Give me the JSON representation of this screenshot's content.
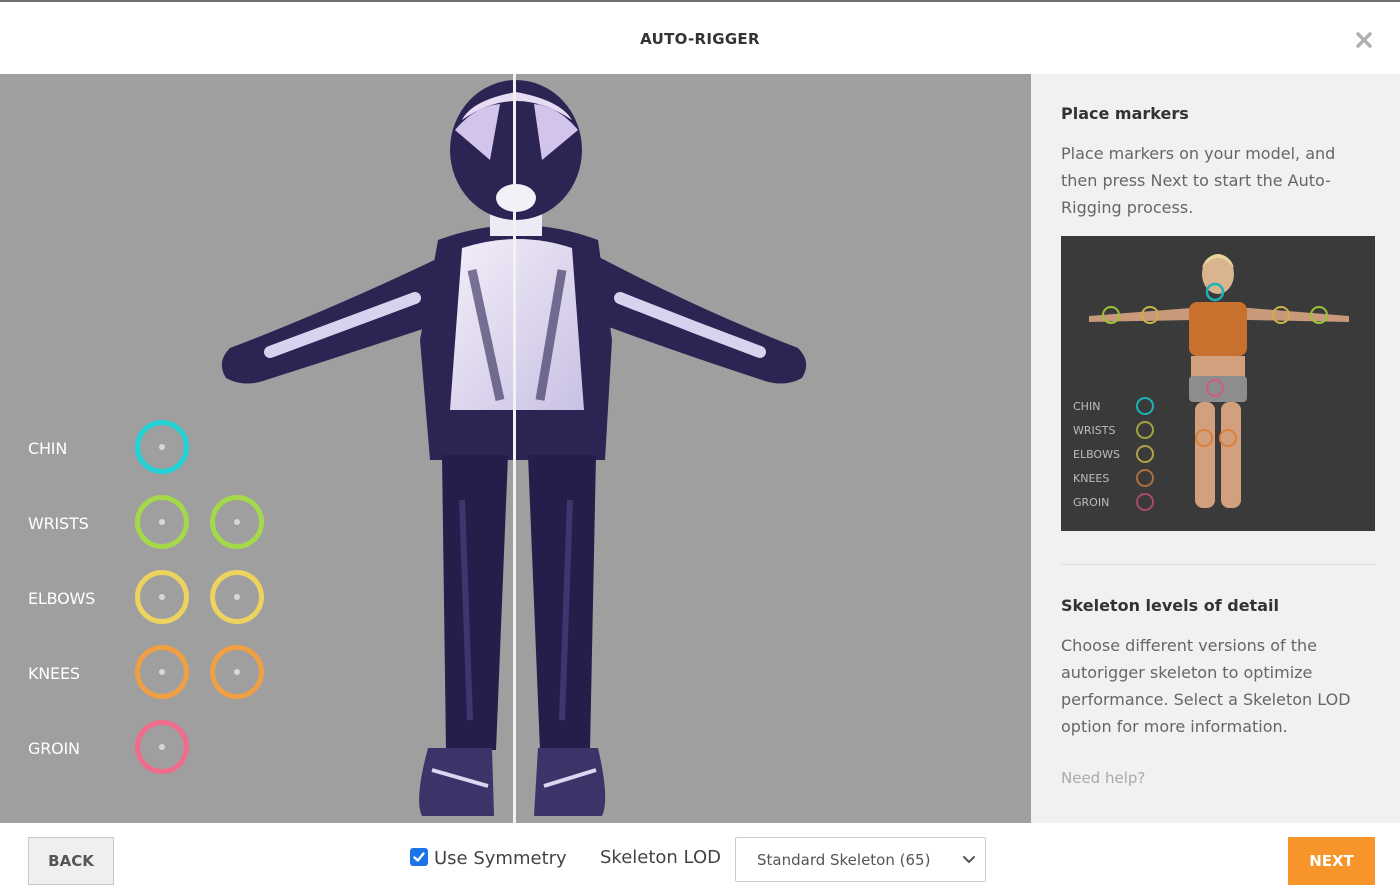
{
  "header": {
    "title": "AUTO-RIGGER"
  },
  "markers": {
    "chin": {
      "label": "CHIN",
      "color": "#22d3d8"
    },
    "wrists": {
      "label": "WRISTS",
      "color": "#a3d94a"
    },
    "elbows": {
      "label": "ELBOWS",
      "color": "#eed35f"
    },
    "knees": {
      "label": "KNEES",
      "color": "#f0a043"
    },
    "groin": {
      "label": "GROIN",
      "color": "#f06b8c"
    }
  },
  "side": {
    "place_title": "Place markers",
    "place_text": "Place markers on your model, and then press Next to start the Auto-Rigging process.",
    "preview_labels": [
      "CHIN",
      "WRISTS",
      "ELBOWS",
      "KNEES",
      "GROIN"
    ],
    "lod_title": "Skeleton levels of detail",
    "lod_text": "Choose different versions of the autorigger skeleton to optimize performance. Select a Skeleton LOD option for more information.",
    "help": "Need help?"
  },
  "footer": {
    "back": "BACK",
    "symmetry_label": "Use Symmetry",
    "symmetry_checked": true,
    "lod_label": "Skeleton LOD",
    "lod_value": "Standard Skeleton (65)",
    "next": "NEXT"
  },
  "colors": {
    "next_button": "#f7952a",
    "viewport_bg": "#9f9f9f",
    "checkbox": "#1a73e8"
  }
}
